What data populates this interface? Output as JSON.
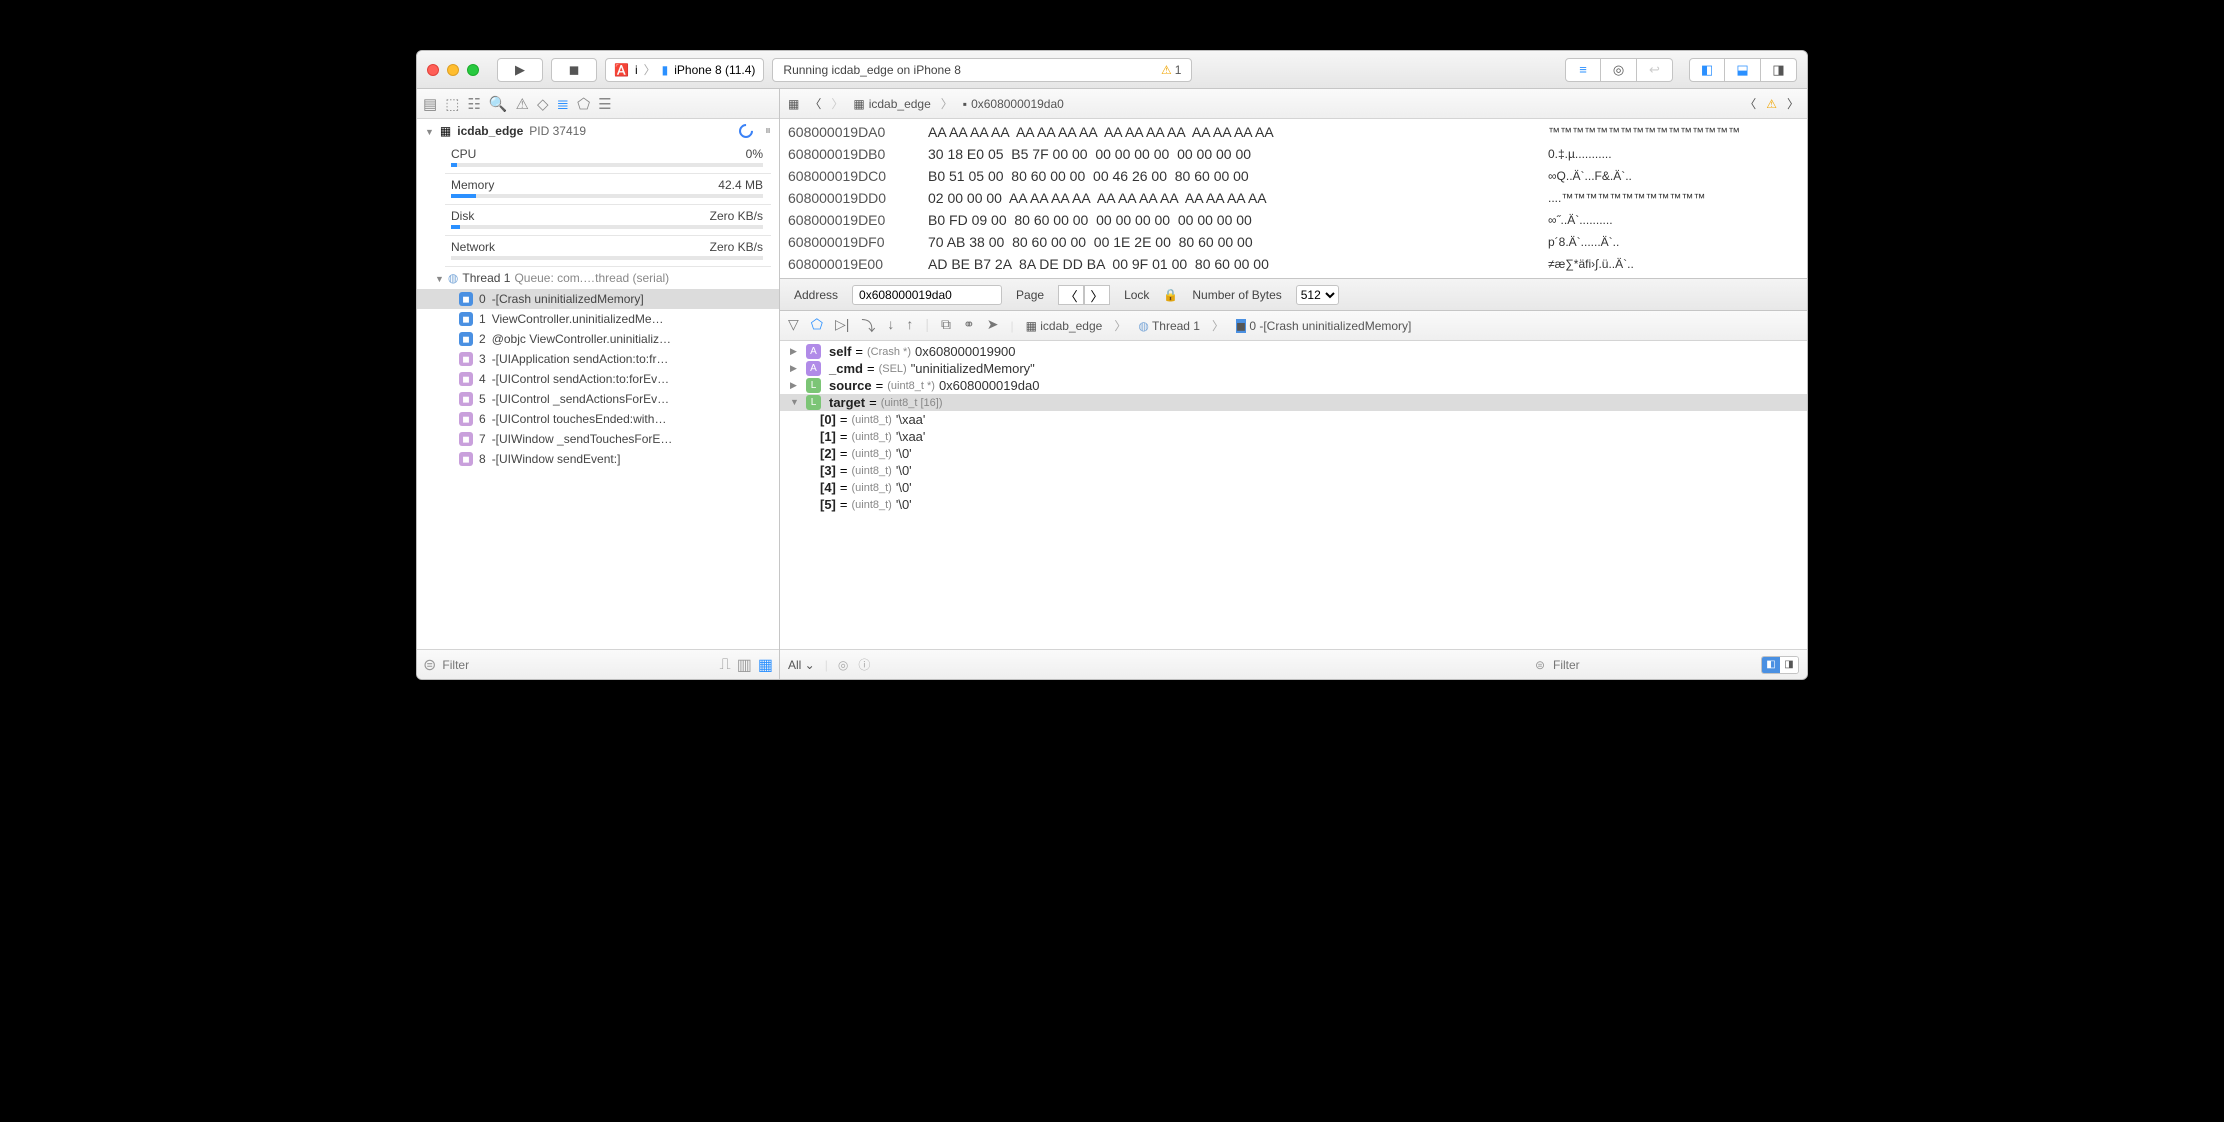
{
  "toolbar": {
    "scheme_app": "i",
    "scheme_device": "iPhone 8 (11.4)",
    "status_text": "Running icdab_edge on iPhone 8",
    "warning_count": "1"
  },
  "sidebar": {
    "process": "icdab_edge",
    "pid_label": "PID 37419",
    "resources": [
      {
        "name": "CPU",
        "value": "0%",
        "fill": 2
      },
      {
        "name": "Memory",
        "value": "42.4 MB",
        "fill": 8
      },
      {
        "name": "Disk",
        "value": "Zero KB/s",
        "fill": 3
      },
      {
        "name": "Network",
        "value": "Zero KB/s",
        "fill": 0
      }
    ],
    "thread_label": "Thread 1",
    "thread_queue": "Queue: com.…thread (serial)",
    "frames": [
      {
        "idx": "0",
        "label": "-[Crash uninitializedMemory]",
        "user": true,
        "selected": true
      },
      {
        "idx": "1",
        "label": "ViewController.uninitializedMe…",
        "user": true
      },
      {
        "idx": "2",
        "label": "@objc ViewController.uninitializ…",
        "user": true
      },
      {
        "idx": "3",
        "label": "-[UIApplication sendAction:to:fr…",
        "user": false
      },
      {
        "idx": "4",
        "label": "-[UIControl sendAction:to:forEv…",
        "user": false
      },
      {
        "idx": "5",
        "label": "-[UIControl _sendActionsForEv…",
        "user": false
      },
      {
        "idx": "6",
        "label": "-[UIControl touchesEnded:with…",
        "user": false
      },
      {
        "idx": "7",
        "label": "-[UIWindow _sendTouchesForE…",
        "user": false
      },
      {
        "idx": "8",
        "label": "-[UIWindow sendEvent:]",
        "user": false
      }
    ],
    "filter_placeholder": "Filter"
  },
  "jumpbar": {
    "item1": "icdab_edge",
    "item2": "0x608000019da0",
    "right_warning": "1"
  },
  "hex": {
    "rows": [
      {
        "addr": "608000019DA0",
        "bytes": "AA AA AA AA  AA AA AA AA  AA AA AA AA  AA AA AA AA",
        "ascii": "™™™™™™™™™™™™™™™™"
      },
      {
        "addr": "608000019DB0",
        "bytes": "30 18 E0 05  B5 7F 00 00  00 00 00 00  00 00 00 00",
        "ascii": "0.‡.µ..........."
      },
      {
        "addr": "608000019DC0",
        "bytes": "B0 51 05 00  80 60 00 00  00 46 26 00  80 60 00 00",
        "ascii": "∞Q..Ä`...F&.Ä`.."
      },
      {
        "addr": "608000019DD0",
        "bytes": "02 00 00 00  AA AA AA AA  AA AA AA AA  AA AA AA AA",
        "ascii": "....™™™™™™™™™™™™"
      },
      {
        "addr": "608000019DE0",
        "bytes": "B0 FD 09 00  80 60 00 00  00 00 00 00  00 00 00 00",
        "ascii": "∞˝..Ä`.........."
      },
      {
        "addr": "608000019DF0",
        "bytes": "70 AB 38 00  80 60 00 00  00 1E 2E 00  80 60 00 00",
        "ascii": "p´8.Ä`......Ä`.."
      },
      {
        "addr": "608000019E00",
        "bytes": "AD BE B7 2A  8A DE DD BA  00 9F 01 00  80 60 00 00",
        "ascii": "≠æ∑*äfi›∫.ü..Ä`.."
      }
    ]
  },
  "memctl": {
    "address_label": "Address",
    "address_value": "0x608000019da0",
    "page_label": "Page",
    "lock_label": "Lock",
    "bytes_label": "Number of Bytes",
    "bytes_value": "512"
  },
  "debugbar": {
    "crumb1": "icdab_edge",
    "crumb2": "Thread 1",
    "crumb3": "0 -[Crash uninitializedMemory]"
  },
  "variables": [
    {
      "badge": "A",
      "name": "self",
      "type": "(Crash *)",
      "value": "0x608000019900",
      "expanded": false
    },
    {
      "badge": "A",
      "name": "_cmd",
      "type": "(SEL)",
      "value": "\"uninitializedMemory\"",
      "expanded": false
    },
    {
      "badge": "L",
      "name": "source",
      "type": "(uint8_t *)",
      "value": "0x608000019da0",
      "expanded": false
    },
    {
      "badge": "L",
      "name": "target",
      "type": "(uint8_t [16])",
      "value": "",
      "expanded": true,
      "selected": true,
      "items": [
        {
          "name": "[0]",
          "type": "(uint8_t)",
          "value": "'\\xaa'"
        },
        {
          "name": "[1]",
          "type": "(uint8_t)",
          "value": "'\\xaa'"
        },
        {
          "name": "[2]",
          "type": "(uint8_t)",
          "value": "'\\0'"
        },
        {
          "name": "[3]",
          "type": "(uint8_t)",
          "value": "'\\0'"
        },
        {
          "name": "[4]",
          "type": "(uint8_t)",
          "value": "'\\0'"
        },
        {
          "name": "[5]",
          "type": "(uint8_t)",
          "value": "'\\0'"
        }
      ]
    }
  ],
  "footer": {
    "scope": "All",
    "filter_placeholder": "Filter"
  }
}
